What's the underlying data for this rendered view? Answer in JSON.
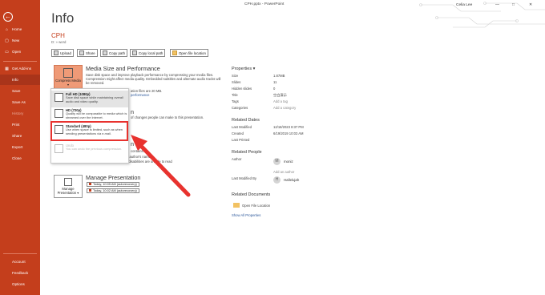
{
  "app": {
    "title": "CPH.pptx - PowerPoint",
    "user": "Celia Lee"
  },
  "sidebar": {
    "items": [
      {
        "label": "Home",
        "icon": "home-icon"
      },
      {
        "label": "New",
        "icon": "new-file-icon"
      },
      {
        "label": "Open",
        "icon": "open-folder-icon"
      },
      {
        "label": "Get Add-ins",
        "icon": "add-ins-icon"
      },
      {
        "label": "Info",
        "icon": ""
      },
      {
        "label": "Save",
        "icon": ""
      },
      {
        "label": "Save As",
        "icon": ""
      },
      {
        "label": "History",
        "icon": ""
      },
      {
        "label": "Print",
        "icon": ""
      },
      {
        "label": "Share",
        "icon": ""
      },
      {
        "label": "Export",
        "icon": ""
      },
      {
        "label": "Close",
        "icon": ""
      }
    ],
    "bottom": [
      {
        "label": "Account"
      },
      {
        "label": "Feedback"
      },
      {
        "label": "Options"
      }
    ],
    "colors": {
      "bg": "#c43e1c",
      "active": "#a9341a"
    }
  },
  "page": {
    "title": "Info",
    "file_name": "CPH",
    "file_path": "D: » word"
  },
  "actions": [
    {
      "label": "Upload"
    },
    {
      "label": "Share"
    },
    {
      "label": "Copy path"
    },
    {
      "label": "Copy local path"
    },
    {
      "label": "Open file location"
    }
  ],
  "media": {
    "button_label": "Compress Media ▾",
    "heading": "Media Size and Performance",
    "desc": "Save disk space and improve playback performance by compressing your media files. Compression might affect media quality. Embedded subtitles and alternate audio tracks will be removed.",
    "size_line": "ation files are 20 MB.",
    "perf_link": "performance"
  },
  "compress_menu": [
    {
      "title": "Full HD (1080p)",
      "desc": "Save disk space while maintaining overall audio and video quality."
    },
    {
      "title": "HD (720p)",
      "desc": "Quality will be comparable to media which is streamed over the Internet."
    },
    {
      "title": "Standard (480p)",
      "desc": "Use when space is limited, such as when sending presentations via e-mail."
    },
    {
      "title": "Undo",
      "desc": "You can undo the previous compression."
    }
  ],
  "protect": {
    "heading_partial": "n",
    "text": "of changes people can make to this presentation."
  },
  "inspect": {
    "heading_partial": "n",
    "text1": "contains:",
    "text2": "document properties and author's name",
    "text3": "Content that people with disabilities are unable to read",
    "issues_btn": "Issues ▾"
  },
  "manage": {
    "button_label": "Manage Presentation ▾",
    "heading": "Manage Presentation",
    "versions": [
      "Today, 10:05 AM (autorecovery)",
      "Today, 10:02 AM (autorecovery)"
    ]
  },
  "properties": {
    "heading": "Properties ▾",
    "rows": [
      {
        "label": "Size",
        "value": "1.87MB"
      },
      {
        "label": "Slides",
        "value": "11"
      },
      {
        "label": "Hidden slides",
        "value": "0"
      },
      {
        "label": "Title",
        "value": "空白演示"
      },
      {
        "label": "Tags",
        "value": "Add a tag"
      },
      {
        "label": "Categories",
        "value": "Add a category"
      }
    ]
  },
  "related_dates": {
    "heading": "Related Dates",
    "rows": [
      {
        "label": "Last Modified",
        "value": "12/18/2023 8:37 PM"
      },
      {
        "label": "Created",
        "value": "6/19/2019 10:03 AM"
      },
      {
        "label": "Last Printed",
        "value": ""
      }
    ]
  },
  "related_people": {
    "heading": "Related People",
    "author_label": "Author",
    "author_name": "moniz",
    "add_author": "Add an author",
    "modified_label": "Last Modified By",
    "modified_name": "Hallelujah"
  },
  "related_docs": {
    "heading": "Related Documents",
    "open_file": "Open File Location",
    "show_all": "Show All Properties"
  },
  "window_controls": {
    "minimize": "—",
    "maximize": "□",
    "close": "✕"
  },
  "annotation_color": "#e8322e"
}
